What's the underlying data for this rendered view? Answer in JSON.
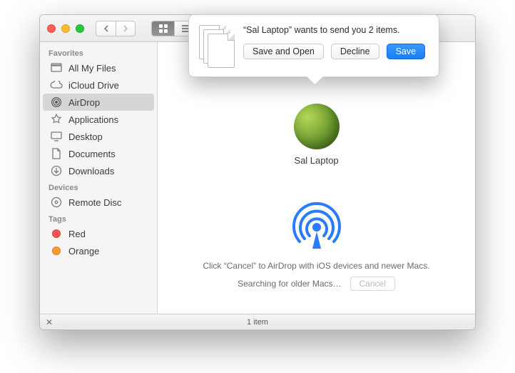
{
  "sidebar": {
    "sections": [
      {
        "heading": "Favorites",
        "items": [
          {
            "icon": "all-my-files-icon",
            "label": "All My Files"
          },
          {
            "icon": "icloud-icon",
            "label": "iCloud Drive"
          },
          {
            "icon": "airdrop-icon",
            "label": "AirDrop",
            "selected": true
          },
          {
            "icon": "applications-icon",
            "label": "Applications"
          },
          {
            "icon": "desktop-icon",
            "label": "Desktop"
          },
          {
            "icon": "documents-icon",
            "label": "Documents"
          },
          {
            "icon": "downloads-icon",
            "label": "Downloads"
          }
        ]
      },
      {
        "heading": "Devices",
        "items": [
          {
            "icon": "remote-disc-icon",
            "label": "Remote Disc"
          }
        ]
      },
      {
        "heading": "Tags",
        "items": [
          {
            "icon": "tag-dot",
            "color": "#ff534f",
            "label": "Red"
          },
          {
            "icon": "tag-dot",
            "color": "#ff9a2f",
            "label": "Orange"
          }
        ]
      }
    ]
  },
  "main": {
    "peer_name": "Sal Laptop",
    "hint": "Click “Cancel” to AirDrop with iOS devices and newer Macs.",
    "searching_text": "Searching for older Macs…",
    "cancel_label": "Cancel"
  },
  "popover": {
    "message": "“Sal Laptop” wants to send you 2 items.",
    "save_and_open_label": "Save and Open",
    "decline_label": "Decline",
    "save_label": "Save"
  },
  "statusbar": {
    "text": "1 item"
  }
}
